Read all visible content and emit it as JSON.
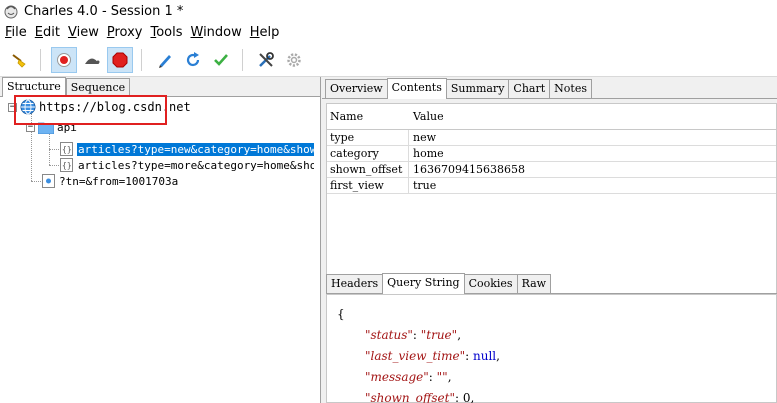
{
  "window": {
    "title": "Charles 4.0 - Session 1 *"
  },
  "menu": [
    {
      "u": "F",
      "rest": "ile"
    },
    {
      "u": "E",
      "rest": "dit"
    },
    {
      "u": "V",
      "rest": "iew"
    },
    {
      "u": "P",
      "rest": "roxy"
    },
    {
      "u": "T",
      "rest": "ools"
    },
    {
      "u": "W",
      "rest": "indow"
    },
    {
      "u": "H",
      "rest": "elp"
    }
  ],
  "toolbar": {
    "icons": [
      "broom-icon",
      "record-icon",
      "throttle-icon",
      "breakpoint-icon",
      "compose-icon",
      "repeat-icon",
      "validate-icon",
      "tools-icon",
      "settings-icon"
    ]
  },
  "left": {
    "tabs": [
      "Structure",
      "Sequence"
    ],
    "tree": {
      "host": "https://blog.csdn.net",
      "folder": "api",
      "item1": "articles?type=new&category=home&shown_of",
      "item2": "articles?type=more&category=home&shown_o",
      "item3": "?tn=&from=1001703a"
    }
  },
  "right": {
    "tabs": [
      "Overview",
      "Contents",
      "Summary",
      "Chart",
      "Notes"
    ],
    "table": {
      "headers": [
        "Name",
        "Value"
      ],
      "rows": [
        [
          "type",
          "new"
        ],
        [
          "category",
          "home"
        ],
        [
          "shown_offset",
          "1636709415638658"
        ],
        [
          "first_view",
          "true"
        ]
      ]
    },
    "bottom_tabs": [
      "Headers",
      "Query String",
      "Cookies",
      "Raw"
    ],
    "json": {
      "open_brace": "{",
      "lines": [
        {
          "key": "\"status\"",
          "val": "\"true\"",
          "type": "s"
        },
        {
          "key": "\"last_view_time\"",
          "val": "null",
          "type": "n"
        },
        {
          "key": "\"message\"",
          "val": "\"\"",
          "type": "s"
        },
        {
          "key": "\"shown_offset\"",
          "val": "0",
          "type": "d"
        }
      ]
    }
  },
  "colors": {
    "selection": "#0078d7",
    "highlight_box": "#e02020"
  }
}
